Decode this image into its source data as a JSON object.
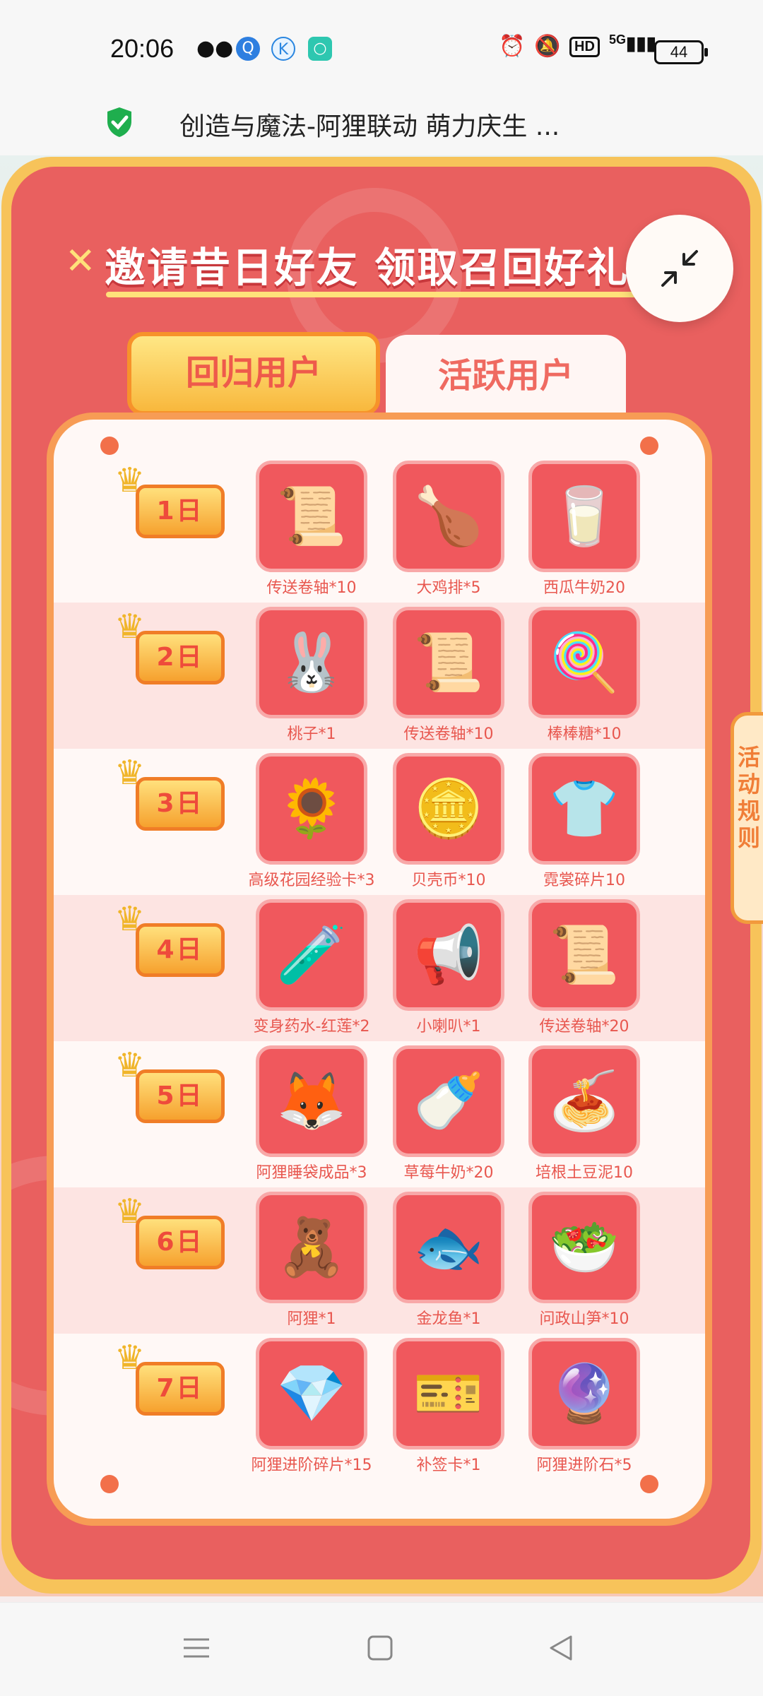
{
  "status_bar": {
    "time": "20:06",
    "left_icons": [
      "wechat-icon",
      "app-q-icon",
      "app-k-icon",
      "app-green-icon"
    ],
    "right_icons": [
      "alarm-icon",
      "mute-icon",
      "hd-icon",
      "signal-5g-icon"
    ],
    "network": "5G",
    "battery": "44"
  },
  "title_bar": {
    "secure_icon": "shield-check-icon",
    "title": "创造与魔法-阿狸联动 萌力庆生 ..."
  },
  "header": {
    "title": "邀请昔日好友 领取召回好礼"
  },
  "tabs": [
    {
      "label": "回归用户",
      "selected": true
    },
    {
      "label": "活跃用户",
      "selected": false
    }
  ],
  "side_tab": {
    "label": "活动规则"
  },
  "days": [
    {
      "day": "1日",
      "rewards": [
        {
          "icon": "scroll-icon",
          "label": "传送卷轴*10"
        },
        {
          "icon": "chicken-steak-icon",
          "label": "大鸡排*5"
        },
        {
          "icon": "watermelon-milk-icon",
          "label": "西瓜牛奶20"
        }
      ]
    },
    {
      "day": "2日",
      "rewards": [
        {
          "icon": "peach-doll-icon",
          "label": "桃子*1"
        },
        {
          "icon": "scroll-icon",
          "label": "传送卷轴*10"
        },
        {
          "icon": "lollipop-icon",
          "label": "棒棒糖*10"
        }
      ]
    },
    {
      "day": "3日",
      "rewards": [
        {
          "icon": "sunflower-card-icon",
          "label": "高级花园经验卡*3"
        },
        {
          "icon": "shell-coin-icon",
          "label": "贝壳币*10"
        },
        {
          "icon": "shirt-fragment-icon",
          "label": "霓裳碎片10"
        }
      ]
    },
    {
      "day": "4日",
      "rewards": [
        {
          "icon": "potion-icon",
          "label": "变身药水-红莲*2"
        },
        {
          "icon": "megaphone-icon",
          "label": "小喇叭*1"
        },
        {
          "icon": "scroll-icon",
          "label": "传送卷轴*20"
        }
      ]
    },
    {
      "day": "5日",
      "rewards": [
        {
          "icon": "ali-sleeping-bag-icon",
          "label": "阿狸睡袋成品*3"
        },
        {
          "icon": "strawberry-milk-icon",
          "label": "草莓牛奶*20"
        },
        {
          "icon": "bacon-mashed-potato-icon",
          "label": "培根土豆泥10"
        }
      ]
    },
    {
      "day": "6日",
      "rewards": [
        {
          "icon": "ali-figure-icon",
          "label": "阿狸*1"
        },
        {
          "icon": "golden-dragon-fish-icon",
          "label": "金龙鱼*1"
        },
        {
          "icon": "asparagus-soup-icon",
          "label": "问政山笋*10"
        }
      ]
    },
    {
      "day": "7日",
      "rewards": [
        {
          "icon": "ali-gem-fragment-icon",
          "label": "阿狸进阶碎片*15"
        },
        {
          "icon": "sign-in-card-icon",
          "label": "补签卡*1"
        },
        {
          "icon": "ali-advance-stone-icon",
          "label": "阿狸进阶石*5"
        }
      ]
    }
  ],
  "nav_bar": [
    "menu-icon",
    "home-square-icon",
    "back-triangle-icon"
  ]
}
